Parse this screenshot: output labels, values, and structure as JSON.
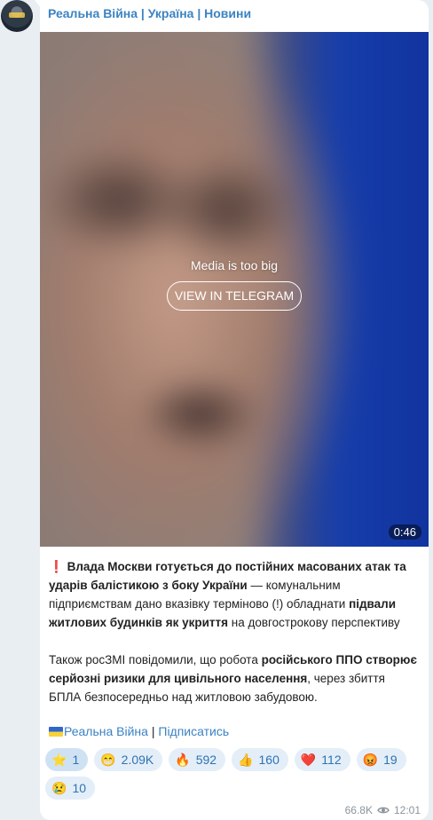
{
  "channel": {
    "name": "Реальна Війна | Україна | Новини"
  },
  "media": {
    "notice": "Media is too big",
    "button_label": "VIEW IN TELEGRAM",
    "duration": "0:46"
  },
  "post": {
    "p1_emoji": "❗",
    "p1_b1": "Влада Москви готується до постійних масованих атак та ударів балістикою з боку України",
    "p1_t1": " — комунальним підприємствам дано вказівку терміново (!) обладнати ",
    "p1_b2": "підвали житлових будинків як укриття",
    "p1_t2": " на довгостроковy перспективу",
    "p2_t1": "Також росЗМІ повідомили, що робота ",
    "p2_b1": "російського ППО створює серйозні ризики для цивільного населення",
    "p2_t2": ", через збиття БПЛА безпосередньо над житловою забудовою."
  },
  "links": {
    "channel_link": "Реальна Війна",
    "separator": " | ",
    "subscribe": "Підписатись"
  },
  "reactions": [
    {
      "emoji": "⭐",
      "count": "1"
    },
    {
      "emoji": "😁",
      "count": "2.09K"
    },
    {
      "emoji": "🔥",
      "count": "592"
    },
    {
      "emoji": "👍",
      "count": "160"
    },
    {
      "emoji": "❤️",
      "count": "112"
    },
    {
      "emoji": "😡",
      "count": "19"
    },
    {
      "emoji": "😢",
      "count": "10"
    }
  ],
  "meta": {
    "views": "66.8K",
    "time": "12:01"
  },
  "colors": {
    "accent": "#3b83c3",
    "background": "#e9eef3",
    "reaction_bg": "#e3eef8"
  }
}
